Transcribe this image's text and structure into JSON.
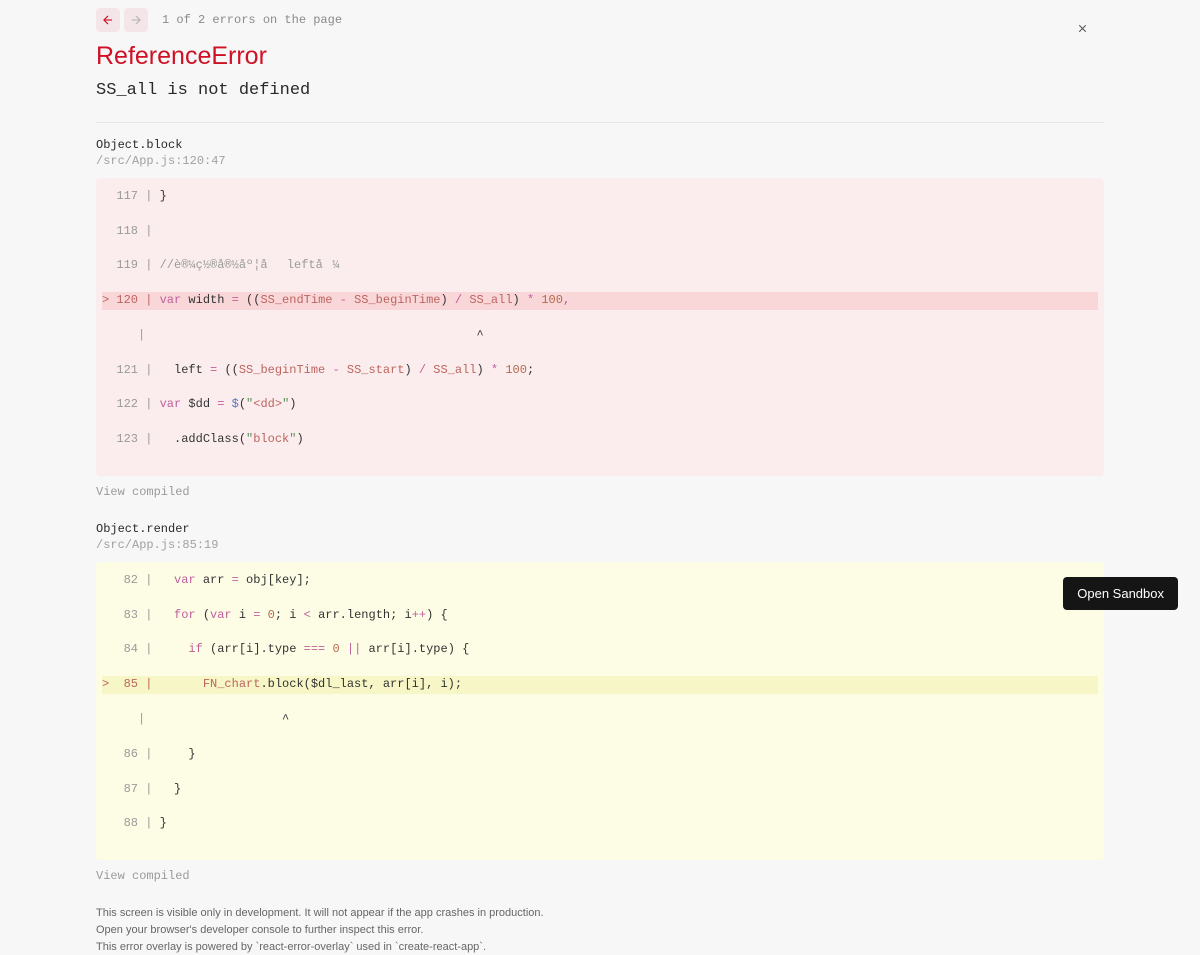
{
  "nav": {
    "error_count_text": "1 of 2 errors on the page"
  },
  "error": {
    "type": "ReferenceError",
    "message": "SS_all is not defined"
  },
  "frames": [
    {
      "func": "Object.block",
      "location": "/src/App.js:120:47",
      "view_compiled": "View compiled"
    },
    {
      "func": "Object.render",
      "location": "/src/App.js:85:19",
      "view_compiled": "View compiled"
    }
  ],
  "code": {
    "frame0": {
      "lines": [
        {
          "n": "117",
          "text": "}"
        },
        {
          "n": "118",
          "text": ""
        },
        {
          "n": "119",
          "comment": "//è®¼ç½®å®½åº¦åleftå¼"
        },
        {
          "n": "120",
          "hl": true,
          "tokens": [
            {
              "t": "var ",
              "c": "kw"
            },
            {
              "t": "width ",
              "c": "plain"
            },
            {
              "t": "= ",
              "c": "op"
            },
            {
              "t": "((",
              "c": "plain"
            },
            {
              "t": "SS_endTime ",
              "c": "ident"
            },
            {
              "t": "- ",
              "c": "op"
            },
            {
              "t": "SS_beginTime",
              "c": "ident"
            },
            {
              "t": ") ",
              "c": "plain"
            },
            {
              "t": "/ ",
              "c": "op"
            },
            {
              "t": "SS_all",
              "c": "ident"
            },
            {
              "t": ") ",
              "c": "plain"
            },
            {
              "t": "* ",
              "c": "op"
            },
            {
              "t": "100",
              "c": "num"
            },
            {
              "t": ",",
              "c": "op"
            }
          ]
        },
        {
          "n": "   ",
          "caret": true,
          "caret_pad": "                                             ^"
        },
        {
          "n": "121",
          "tokens": [
            {
              "t": "  left ",
              "c": "plain"
            },
            {
              "t": "= ",
              "c": "op"
            },
            {
              "t": "((",
              "c": "plain"
            },
            {
              "t": "SS_beginTime ",
              "c": "ident"
            },
            {
              "t": "- ",
              "c": "op"
            },
            {
              "t": "SS_start",
              "c": "ident"
            },
            {
              "t": ") ",
              "c": "plain"
            },
            {
              "t": "/ ",
              "c": "op"
            },
            {
              "t": "SS_all",
              "c": "ident"
            },
            {
              "t": ") ",
              "c": "plain"
            },
            {
              "t": "* ",
              "c": "op"
            },
            {
              "t": "100",
              "c": "num"
            },
            {
              "t": ";",
              "c": "plain"
            }
          ]
        },
        {
          "n": "122",
          "tokens": [
            {
              "t": "var ",
              "c": "kw"
            },
            {
              "t": "$dd ",
              "c": "plain"
            },
            {
              "t": "= ",
              "c": "op"
            },
            {
              "t": "$",
              "c": "fn"
            },
            {
              "t": "(",
              "c": "plain"
            },
            {
              "t": "\"",
              "c": "str"
            },
            {
              "t": "<dd>",
              "c": "str-inner"
            },
            {
              "t": "\"",
              "c": "str"
            },
            {
              "t": ")",
              "c": "plain"
            }
          ]
        },
        {
          "n": "123",
          "tokens": [
            {
              "t": "  .addClass(",
              "c": "plain"
            },
            {
              "t": "\"",
              "c": "str"
            },
            {
              "t": "block",
              "c": "str-inner"
            },
            {
              "t": "\"",
              "c": "str"
            },
            {
              "t": ")",
              "c": "plain"
            }
          ]
        }
      ]
    },
    "frame1": {
      "lines": [
        {
          "n": "82",
          "tokens": [
            {
              "t": "  var ",
              "c": "kw"
            },
            {
              "t": "arr ",
              "c": "plain"
            },
            {
              "t": "= ",
              "c": "op"
            },
            {
              "t": "obj[key];",
              "c": "plain"
            }
          ]
        },
        {
          "n": "83",
          "tokens": [
            {
              "t": "  for ",
              "c": "kw"
            },
            {
              "t": "(",
              "c": "plain"
            },
            {
              "t": "var ",
              "c": "kw"
            },
            {
              "t": "i ",
              "c": "plain"
            },
            {
              "t": "= ",
              "c": "op"
            },
            {
              "t": "0",
              "c": "num"
            },
            {
              "t": "; i ",
              "c": "plain"
            },
            {
              "t": "< ",
              "c": "op"
            },
            {
              "t": "arr.length; i",
              "c": "plain"
            },
            {
              "t": "++",
              "c": "op"
            },
            {
              "t": ") {",
              "c": "plain"
            }
          ]
        },
        {
          "n": "84",
          "tokens": [
            {
              "t": "    if ",
              "c": "kw"
            },
            {
              "t": "(arr[i].type ",
              "c": "plain"
            },
            {
              "t": "=== ",
              "c": "op"
            },
            {
              "t": "0 ",
              "c": "num"
            },
            {
              "t": "|| ",
              "c": "op"
            },
            {
              "t": "arr[i].type) {",
              "c": "plain"
            }
          ]
        },
        {
          "n": "85",
          "hl": true,
          "tokens": [
            {
              "t": "      ",
              "c": "plain"
            },
            {
              "t": "FN_chart",
              "c": "ident"
            },
            {
              "t": ".block($dl_last, arr[i], i);",
              "c": "plain"
            }
          ]
        },
        {
          "n": "  ",
          "caret": true,
          "caret_pad": "                  ^"
        },
        {
          "n": "86",
          "text": "    }"
        },
        {
          "n": "87",
          "text": "  }"
        },
        {
          "n": "88",
          "text": "}"
        }
      ]
    }
  },
  "footer": {
    "line1": "This screen is visible only in development. It will not appear if the app crashes in production.",
    "line2": "Open your browser's developer console to further inspect this error.",
    "line3": "This error overlay is powered by `react-error-overlay` used in `create-react-app`."
  },
  "sandbox_button": "Open Sandbox"
}
